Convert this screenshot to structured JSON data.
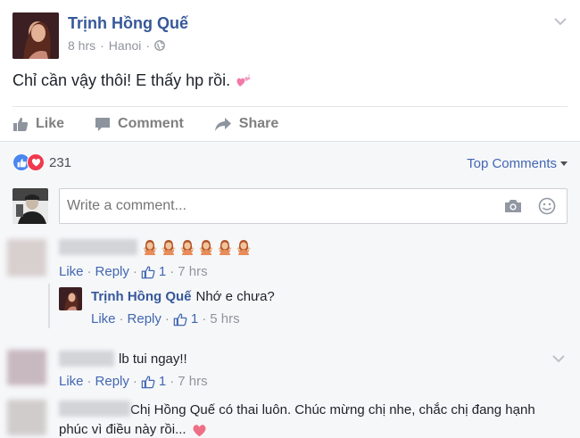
{
  "post": {
    "author": "Trịnh Hồng Quế",
    "time": "8 hrs",
    "location": "Hanoi",
    "separator": "·",
    "text": "Chỉ cần vậy thôi! E thấy hp rồi."
  },
  "actions": {
    "like": "Like",
    "comment": "Comment",
    "share": "Share"
  },
  "reactions": {
    "count": "231",
    "top_comments": "Top Comments"
  },
  "composer": {
    "placeholder": "Write a comment..."
  },
  "comments": [
    {
      "emoji_count": 6,
      "like": "Like",
      "reply": "Reply",
      "likes": "1",
      "time": "7 hrs",
      "reply_item": {
        "author": "Trịnh Hồng Quế",
        "text": "Nhớ e chưa?",
        "like": "Like",
        "reply": "Reply",
        "likes": "1",
        "time": "5 hrs"
      }
    },
    {
      "text": "lb tui ngay!!",
      "like": "Like",
      "reply": "Reply",
      "likes": "1",
      "time": "7 hrs"
    },
    {
      "text_line1": "Chị Hồng Quế có thai luôn. Chúc mừng chị nhe, chắc chị đang hạnh",
      "text_line2": "phúc vì điều này rồi..."
    }
  ],
  "colors": {
    "name_blue": "#365899",
    "link_blue": "#4267b2",
    "like_blue": "#4a86f0",
    "love_red": "#f0384e"
  }
}
